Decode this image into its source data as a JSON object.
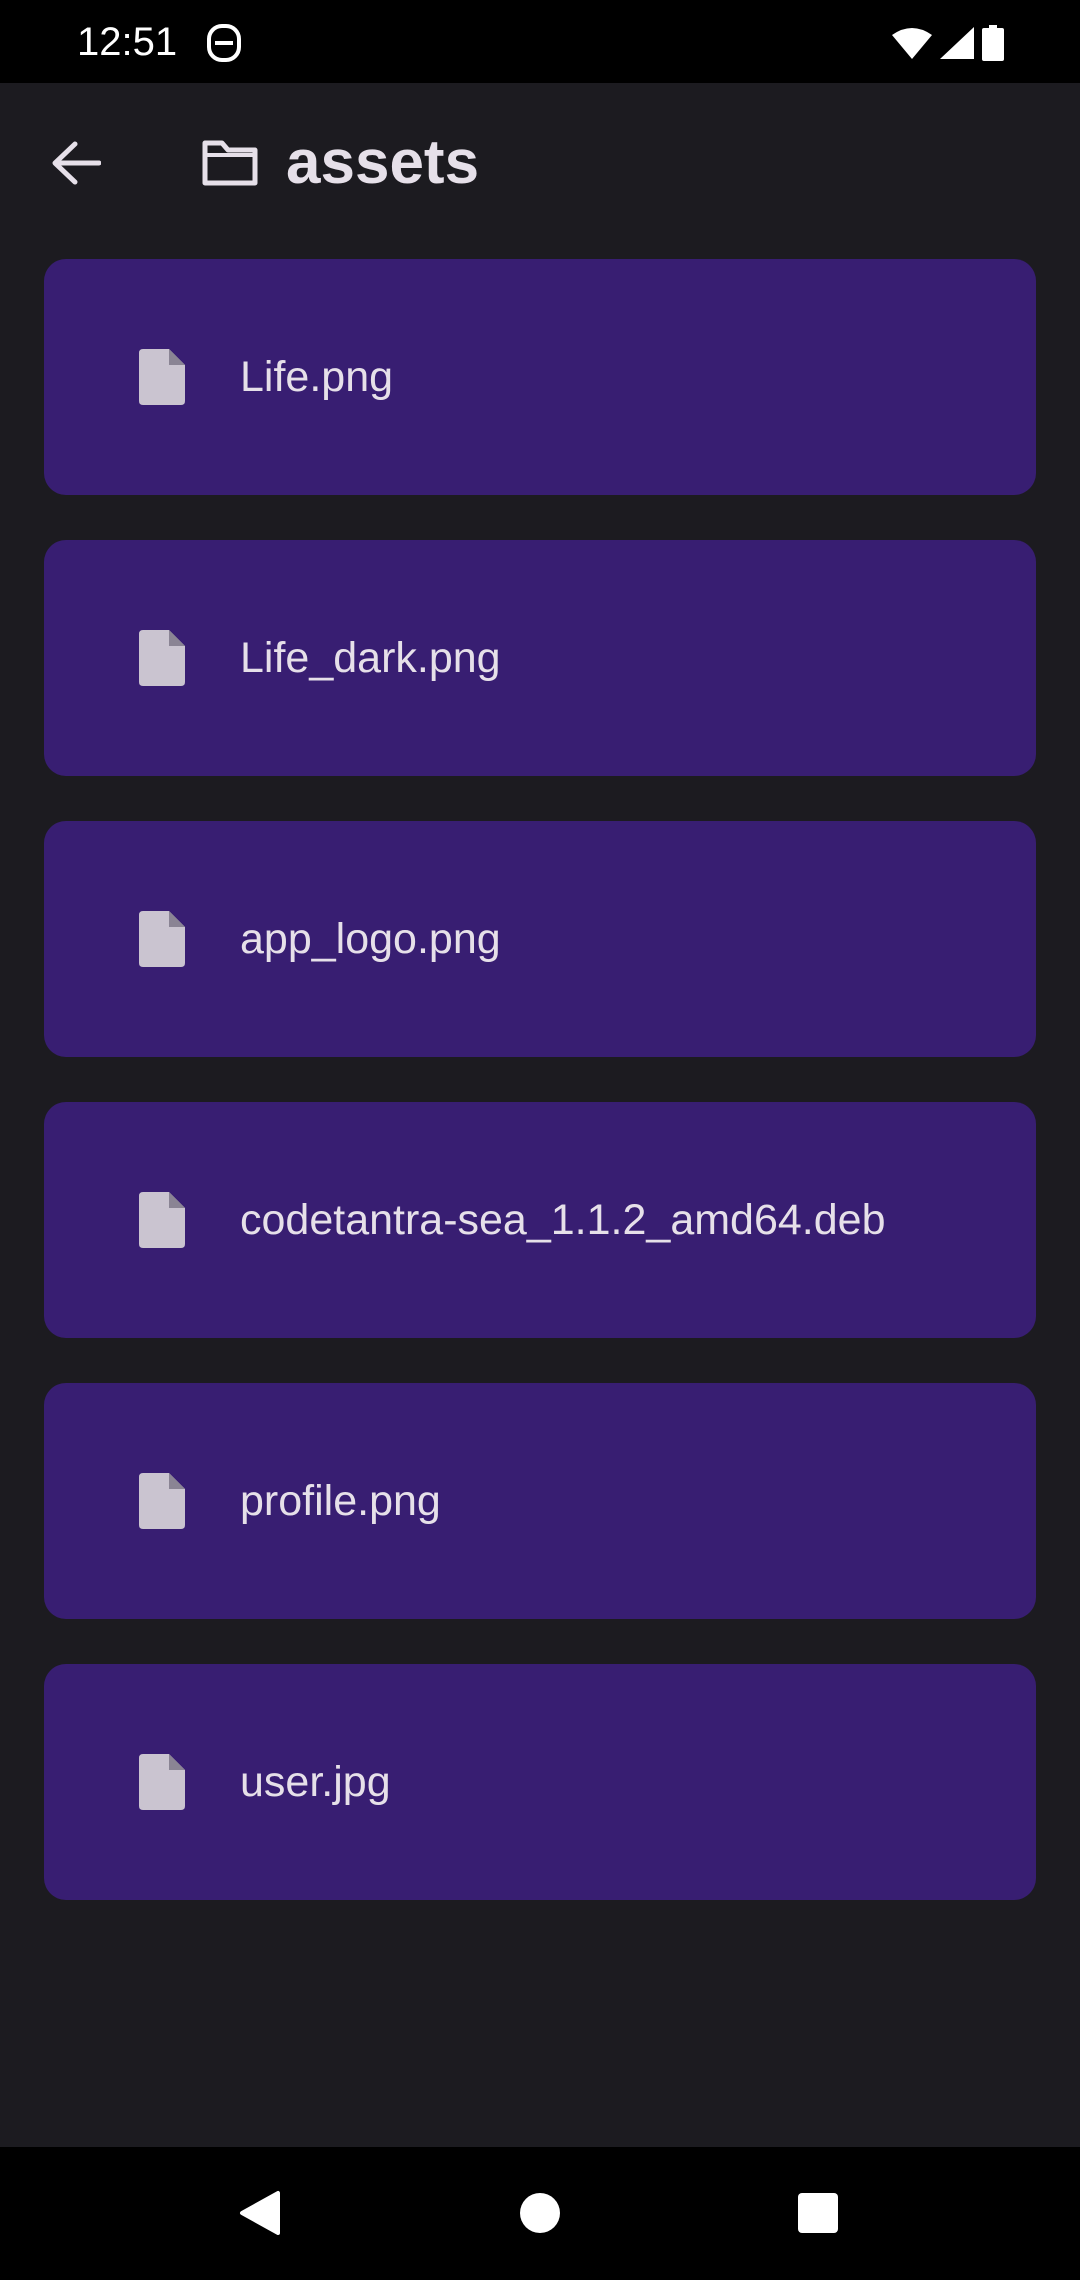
{
  "status_bar": {
    "time": "12:51",
    "app_icon": "app-notification-icon",
    "icons": [
      "wifi-icon",
      "cellular-signal-icon",
      "battery-icon"
    ]
  },
  "app_bar": {
    "back_icon": "arrow-back-icon",
    "folder_icon": "folder-outline-icon",
    "title": "assets"
  },
  "files": [
    {
      "name": "Life.png",
      "icon": "file-icon"
    },
    {
      "name": "Life_dark.png",
      "icon": "file-icon"
    },
    {
      "name": "app_logo.png",
      "icon": "file-icon"
    },
    {
      "name": "codetantra-sea_1.1.2_amd64.deb",
      "icon": "file-icon"
    },
    {
      "name": "profile.png",
      "icon": "file-icon"
    },
    {
      "name": "user.jpg",
      "icon": "file-icon"
    }
  ],
  "nav_bar": {
    "buttons": [
      "back-triangle-icon",
      "home-circle-icon",
      "recents-square-icon"
    ]
  },
  "colors": {
    "background": "#1c1b20",
    "card": "#381e72",
    "text": "#e6e0e9",
    "file_icon": "#cac4d0",
    "system_bars": "#000000"
  }
}
